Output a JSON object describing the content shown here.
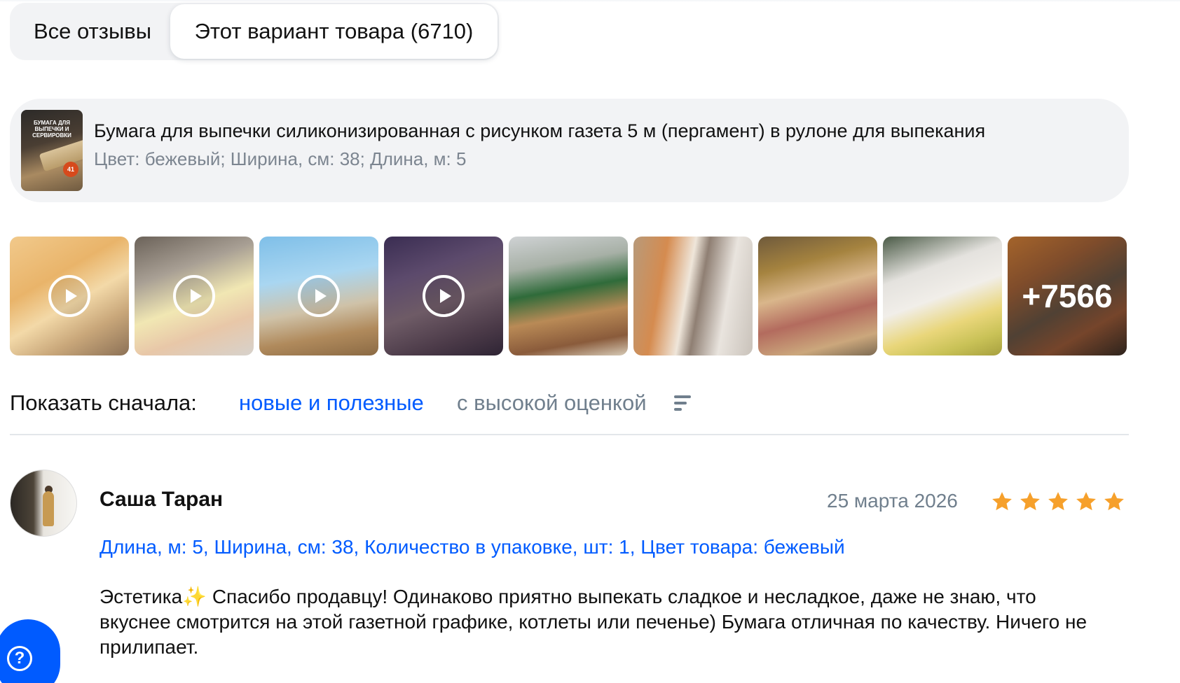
{
  "tabs": {
    "all_reviews": "Все отзывы",
    "this_variant": "Этот вариант товара (6710)"
  },
  "product": {
    "title": "Бумага для выпечки силиконизированная с рисунком газета 5 м (пергамент) в рулоне для выпекания",
    "variant": "Цвет: бежевый; Ширина, см: 38; Длина, м: 5",
    "thumb_text": "БУМАГА ДЛЯ ВЫПЕЧКИ И СЕРВИРОВКИ",
    "thumb_badge": "41"
  },
  "gallery": {
    "items": [
      {
        "kind": "video",
        "icon": "play-icon"
      },
      {
        "kind": "video",
        "icon": "play-icon"
      },
      {
        "kind": "video",
        "icon": "play-icon"
      },
      {
        "kind": "video",
        "icon": "play-icon"
      },
      {
        "kind": "photo"
      },
      {
        "kind": "photo"
      },
      {
        "kind": "photo"
      },
      {
        "kind": "photo"
      },
      {
        "kind": "more"
      }
    ],
    "more_count": "+7566"
  },
  "sort": {
    "label": "Показать сначала:",
    "new_useful": "новые и полезные",
    "high_rating": "с высокой оценкой",
    "icon": "sort-icon"
  },
  "review": {
    "author": "Саша Таран",
    "date": "25 марта 2026",
    "rating": 5,
    "specs": "Длина, м: 5, Ширина, см: 38, Количество в упаковке, шт: 1, Цвет товара: бежевый",
    "text": "Эстетика✨ Спасибо продавцу! Одинаково приятно выпекать сладкое и несладкое, даже не знаю, что вкуснее смотрится на этой газетной графике, котлеты или печенье) Бумага отличная по качеству. Ничего не прилипает."
  },
  "help": {
    "icon": "question-icon",
    "glyph": "?"
  },
  "colors": {
    "accent": "#005bff",
    "star": "#f6a02b",
    "muted": "#707f8d",
    "panel": "#f2f3f5"
  }
}
